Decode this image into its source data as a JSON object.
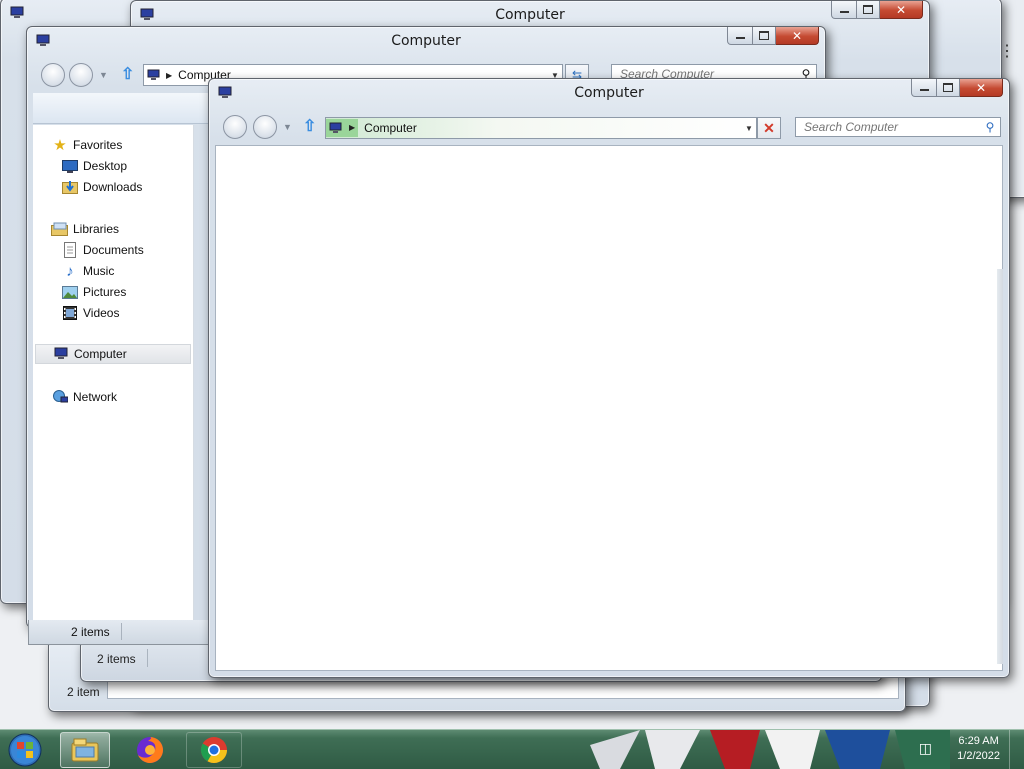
{
  "windows": {
    "back1": {
      "title": "Computer",
      "status_items": "2 item"
    },
    "back2": {
      "title": "Computer",
      "search_placeholder": "Search Computer",
      "status_items": "2 items"
    },
    "middle": {
      "title": "Computer",
      "address": "Computer",
      "search_placeholder": "Search Computer",
      "status_items": "2 items",
      "nav": {
        "favorites": "Favorites",
        "desktop": "Desktop",
        "downloads": "Downloads",
        "libraries": "Libraries",
        "documents": "Documents",
        "music": "Music",
        "pictures": "Pictures",
        "videos": "Videos",
        "computer": "Computer",
        "network": "Network"
      }
    },
    "front": {
      "title": "Computer",
      "address": "Computer",
      "search_placeholder": "Search Computer"
    }
  },
  "taskbar": {
    "clock_time": "6:29 AM",
    "clock_date": "1/2/2022",
    "buttons": [
      "start-orb",
      "windows-explorer",
      "firefox",
      "chrome"
    ]
  },
  "colors": {
    "taskbar": "#3f6e55",
    "close_button": "#c54a32",
    "address_highlight": "#7fd27f"
  }
}
